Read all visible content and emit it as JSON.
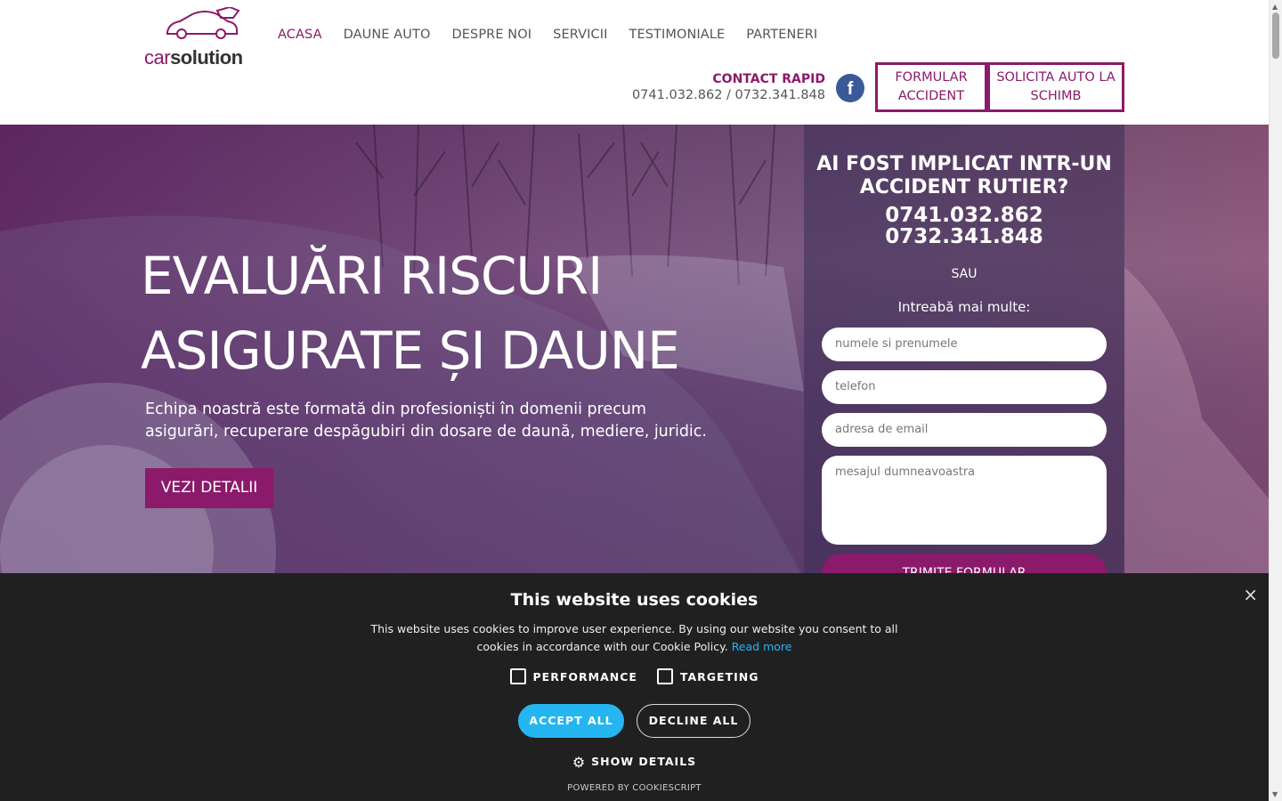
{
  "header": {
    "logo": {
      "car": "car",
      "solution": "solution"
    },
    "nav": [
      {
        "label": "ACASA",
        "active": true
      },
      {
        "label": "DAUNE AUTO"
      },
      {
        "label": "DESPRE NOI"
      },
      {
        "label": "SERVICII"
      },
      {
        "label": "TESTIMONIALE"
      },
      {
        "label": "PARTENERI"
      }
    ],
    "contact_title": "CONTACT RAPID",
    "contact_phones": "0741.032.862 / 0732.341.848",
    "facebook": "f",
    "btn_formular": "FORMULAR ACCIDENT",
    "btn_solicita": "SOLICITA AUTO LA SCHIMB"
  },
  "hero": {
    "title_line1": "EVALUĂRI RISCURI",
    "title_line2": "ASIGURATE ȘI DAUNE",
    "description": "Echipa noastră este formată din profesioniști în domenii precum asigurări, recuperare despăgubiri din dosare de daună, mediere, juridic.",
    "cta": "VEZI DETALII"
  },
  "panel": {
    "question": "AI FOST IMPLICAT INTR-UN ACCIDENT RUTIER?",
    "phone1": "0741.032.862",
    "phone2": "0732.341.848",
    "or": "SAU",
    "ask": "Intreabă mai multe:",
    "ph_name": "numele si prenumele",
    "ph_phone": "telefon",
    "ph_email": "adresa de email",
    "ph_message": "mesajul dumneavoastra",
    "submit": "TRIMITE FORMULAR"
  },
  "cookie": {
    "title": "This website uses cookies",
    "message": "This website uses cookies to improve user experience. By using our website you consent to all cookies in accordance with our Cookie Policy.",
    "read_more": "Read more",
    "performance": "PERFORMANCE",
    "targeting": "TARGETING",
    "accept": "ACCEPT ALL",
    "decline": "DECLINE ALL",
    "details": "SHOW DETAILS",
    "powered": "POWERED BY COOKIESCRIPT",
    "close": "×"
  },
  "colors": {
    "brand": "#8b1a6b",
    "accept": "#25b5f0",
    "banner": "#202020",
    "facebook": "#3b5998"
  }
}
